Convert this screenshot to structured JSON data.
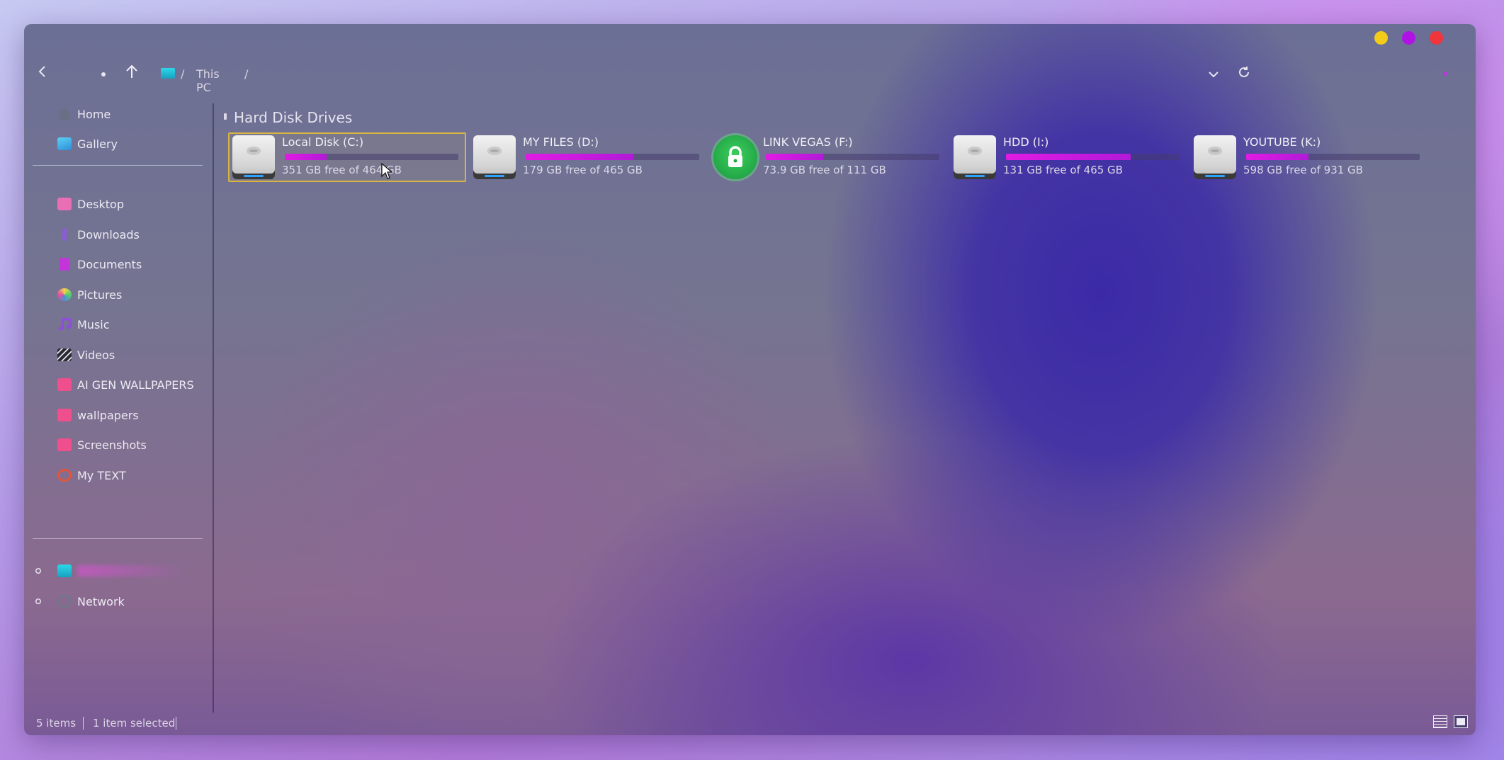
{
  "window_controls": {
    "minimize_color": "#f3cb1a",
    "maximize_color": "#b012e6",
    "close_color": "#f0353b"
  },
  "toolbar": {
    "back_icon": "back-arrow-icon",
    "up_icon": "up-arrow-icon",
    "breadcrumb": {
      "pc_icon": "monitor-icon",
      "separator": "/",
      "location": "This PC",
      "trailing_separator": "/"
    },
    "dropdown_icon": "chevron-down-icon",
    "refresh_icon": "refresh-icon"
  },
  "sidebar": {
    "quick": [
      {
        "label": "Home",
        "icon": "home-icon",
        "color": "#6a6f86"
      },
      {
        "label": "Gallery",
        "icon": "gallery-icon",
        "color": "#37a7e0"
      }
    ],
    "folders": [
      {
        "label": "Desktop",
        "icon": "desktop-icon",
        "color": "#e86fb3"
      },
      {
        "label": "Downloads",
        "icon": "downloads-icon",
        "color": "#8b5cd6"
      },
      {
        "label": "Documents",
        "icon": "documents-icon",
        "color": "#c334d9"
      },
      {
        "label": "Pictures",
        "icon": "pictures-icon",
        "color": "#4f8fd6"
      },
      {
        "label": "Music",
        "icon": "music-icon",
        "color": "#8b4fd9"
      },
      {
        "label": "Videos",
        "icon": "videos-icon",
        "color": "#2a2a33"
      },
      {
        "label": "AI GEN WALLPAPERS",
        "icon": "folder-icon",
        "color": "#ef4f8d"
      },
      {
        "label": "wallpapers",
        "icon": "folder-icon",
        "color": "#ef4f8d"
      },
      {
        "label": "Screenshots",
        "icon": "folder-icon",
        "color": "#ef4f8d"
      },
      {
        "label": "My TEXT",
        "icon": "no-entry-icon",
        "color": "#e2553a"
      }
    ],
    "roots": [
      {
        "label": "Network",
        "icon": "network-icon",
        "color": "#6a7a86"
      }
    ]
  },
  "main": {
    "section_title": "Hard Disk Drives",
    "drives": [
      {
        "name": "Local Disk (C:)",
        "free_text": "351 GB free of 464 GB",
        "used_fraction": 0.24,
        "icon": "hard-drive-icon",
        "selected": true
      },
      {
        "name": "MY FILES (D:)",
        "free_text": "179 GB free of 465 GB",
        "used_fraction": 0.62,
        "icon": "hard-drive-icon",
        "selected": false
      },
      {
        "name": "LINK VEGAS (F:)",
        "free_text": "73.9 GB free of 111 GB",
        "used_fraction": 0.33,
        "icon": "lock-icon",
        "selected": false
      },
      {
        "name": "HDD (I:)",
        "free_text": "131 GB free of 465 GB",
        "used_fraction": 0.72,
        "icon": "hard-drive-icon",
        "selected": false
      },
      {
        "name": "YOUTUBE (K:)",
        "free_text": "598 GB free of 931 GB",
        "used_fraction": 0.36,
        "icon": "hard-drive-icon",
        "selected": false
      }
    ]
  },
  "statusbar": {
    "items_count": "5 items",
    "selection": "1 item selected",
    "details_view_icon": "details-view-icon",
    "tiles_view_icon": "tiles-view-icon"
  }
}
